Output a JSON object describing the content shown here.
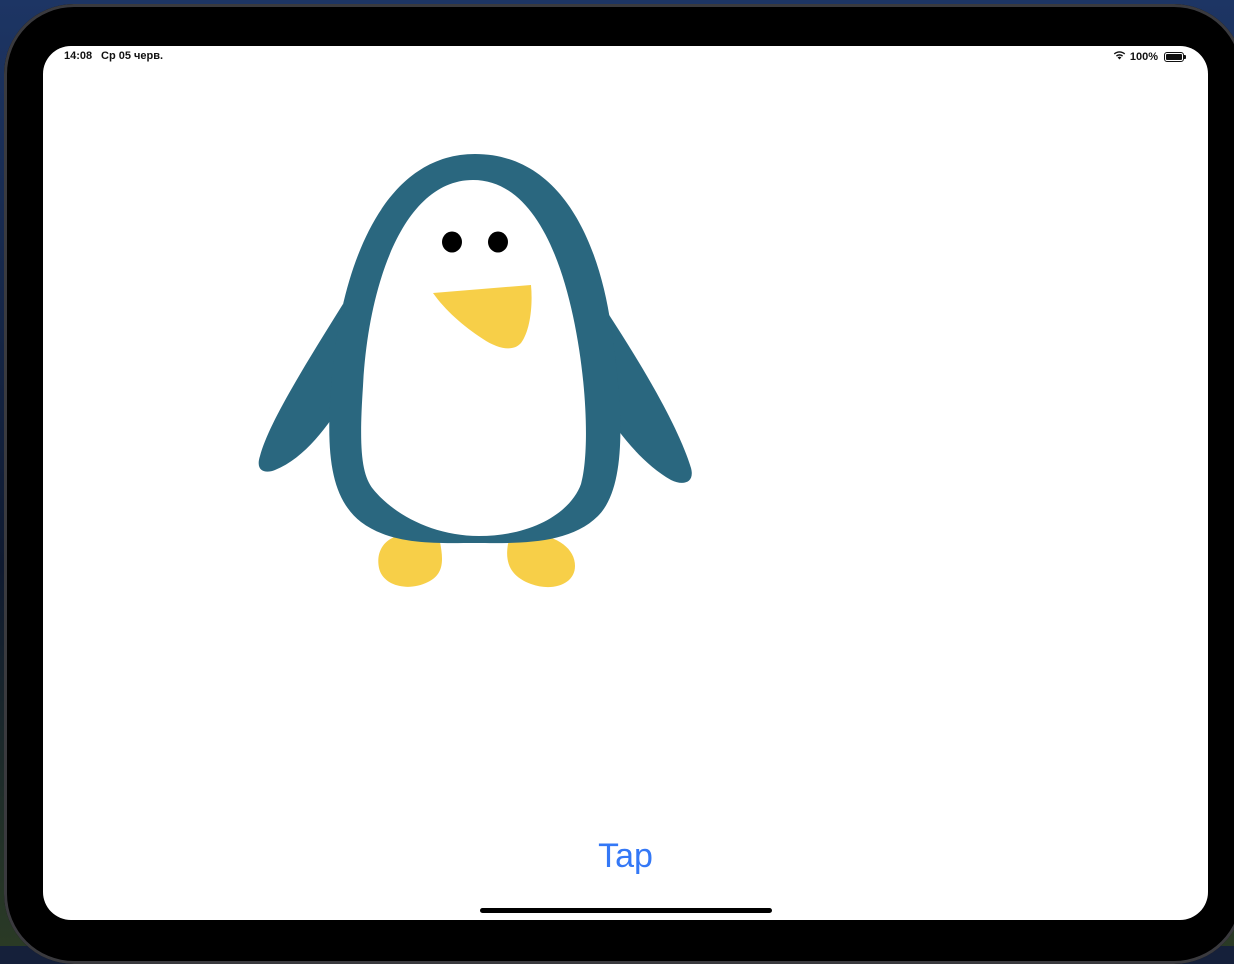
{
  "status_bar": {
    "time": "14:08",
    "date": "Ср 05 черв.",
    "battery_text": "100%",
    "battery_level": 1.0,
    "wifi_icon": "wifi-icon",
    "battery_icon": "battery-icon"
  },
  "illustration": {
    "subject": "penguin",
    "colors": {
      "body": "#2a677f",
      "belly": "#ffffff",
      "beak": "#f7cf48",
      "feet": "#f7cf48",
      "eyes": "#000000"
    }
  },
  "main": {
    "tap_label": "Tap",
    "accent_color": "#3478f6"
  }
}
